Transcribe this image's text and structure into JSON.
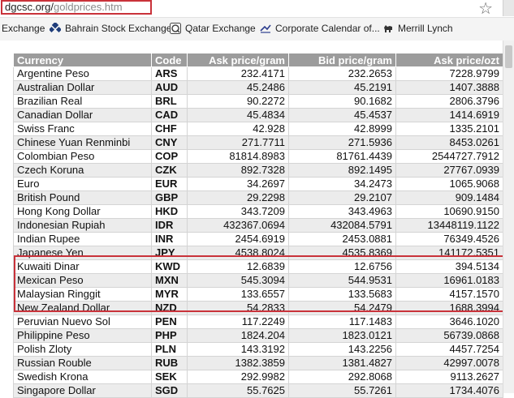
{
  "browser": {
    "address_host": "dgcsc.org/",
    "address_path": "goldprices.htm"
  },
  "bookmarks": [
    {
      "label": "Exchange",
      "icon": "none"
    },
    {
      "label": "Bahrain Stock Exchange",
      "icon": "bse-logo-icon"
    },
    {
      "label": "Qatar Exchange",
      "icon": "qatar-exchange-icon"
    },
    {
      "label": "Corporate Calendar of...",
      "icon": "calendar-logo-icon"
    },
    {
      "label": "Merrill Lynch",
      "icon": "merrill-bull-icon"
    }
  ],
  "table": {
    "headers": [
      "Currency",
      "Code",
      "Ask price/gram",
      "Bid price/gram",
      "Ask price/ozt"
    ],
    "rows": [
      [
        "Argentine Peso",
        "ARS",
        "232.4171",
        "232.2653",
        "7228.9799"
      ],
      [
        "Australian Dollar",
        "AUD",
        "45.2486",
        "45.2191",
        "1407.3888"
      ],
      [
        "Brazilian Real",
        "BRL",
        "90.2272",
        "90.1682",
        "2806.3796"
      ],
      [
        "Canadian Dollar",
        "CAD",
        "45.4834",
        "45.4537",
        "1414.6919"
      ],
      [
        "Swiss Franc",
        "CHF",
        "42.928",
        "42.8999",
        "1335.2101"
      ],
      [
        "Chinese Yuan Renminbi",
        "CNY",
        "271.7711",
        "271.5936",
        "8453.0261"
      ],
      [
        "Colombian Peso",
        "COP",
        "81814.8983",
        "81761.4439",
        "2544727.7912"
      ],
      [
        "Czech Koruna",
        "CZK",
        "892.7328",
        "892.1495",
        "27767.0939"
      ],
      [
        "Euro",
        "EUR",
        "34.2697",
        "34.2473",
        "1065.9068"
      ],
      [
        "British Pound",
        "GBP",
        "29.2298",
        "29.2107",
        "909.1484"
      ],
      [
        "Hong Kong Dollar",
        "HKD",
        "343.7209",
        "343.4963",
        "10690.9150"
      ],
      [
        "Indonesian Rupiah",
        "IDR",
        "432367.0694",
        "432084.5791",
        "13448119.1122"
      ],
      [
        "Indian Rupee",
        "INR",
        "2454.6919",
        "2453.0881",
        "76349.4526"
      ],
      [
        "Japanese Yen",
        "JPY",
        "4538.8024",
        "4535.8369",
        "141172.5351"
      ],
      [
        "Kuwaiti Dinar",
        "KWD",
        "12.6839",
        "12.6756",
        "394.5134"
      ],
      [
        "Mexican Peso",
        "MXN",
        "545.3094",
        "544.9531",
        "16961.0183"
      ],
      [
        "Malaysian Ringgit",
        "MYR",
        "133.6557",
        "133.5683",
        "4157.1570"
      ],
      [
        "New Zealand Dollar",
        "NZD",
        "54.2833",
        "54.2479",
        "1688.3994"
      ],
      [
        "Peruvian Nuevo Sol",
        "PEN",
        "117.2249",
        "117.1483",
        "3646.1020"
      ],
      [
        "Philippine Peso",
        "PHP",
        "1824.204",
        "1823.0121",
        "56739.0868"
      ],
      [
        "Polish Zloty",
        "PLN",
        "143.3192",
        "143.2256",
        "4457.7254"
      ],
      [
        "Russian Rouble",
        "RUB",
        "1382.3859",
        "1381.4827",
        "42997.0078"
      ],
      [
        "Swedish Krona",
        "SEK",
        "292.9982",
        "292.8068",
        "9113.2627"
      ],
      [
        "Singapore Dollar",
        "SGD",
        "55.7625",
        "55.7261",
        "1734.4076"
      ]
    ]
  },
  "colors": {
    "header_bg": "#9c9c9c",
    "highlight_border": "#c9323a",
    "row_alt": "#ececec"
  }
}
